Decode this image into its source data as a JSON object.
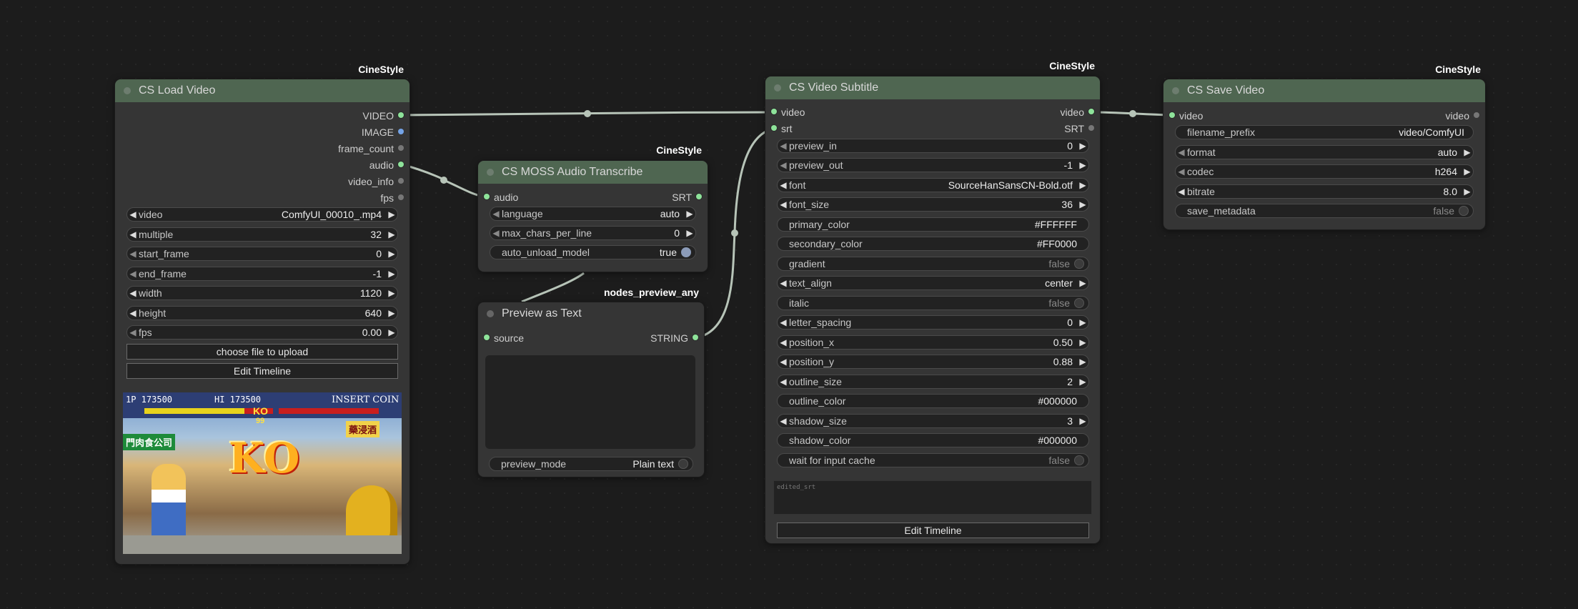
{
  "nodes": {
    "load_video": {
      "badge": "CineStyle",
      "title": "CS Load Video",
      "outputs": [
        "VIDEO",
        "IMAGE",
        "frame_count",
        "audio",
        "video_info",
        "fps"
      ],
      "widgets": [
        {
          "name": "video",
          "value": "ComfyUI_00010_.mp4"
        },
        {
          "name": "multiple",
          "value": "32"
        },
        {
          "name": "start_frame",
          "value": "0"
        },
        {
          "name": "end_frame",
          "value": "-1"
        },
        {
          "name": "width",
          "value": "1120"
        },
        {
          "name": "height",
          "value": "640"
        },
        {
          "name": "fps",
          "value": "0.00"
        }
      ],
      "upload_button": "choose file to upload",
      "timeline_button": "Edit Timeline",
      "preview": {
        "score_left": "1P  173500",
        "hi": "HI  173500",
        "insert_coin": "INSERT COIN",
        "ko": "KO",
        "timer": "99",
        "sign_left": "門肉食公司",
        "sign_right": "藥浸酒"
      }
    },
    "moss_audio": {
      "badge": "CineStyle",
      "title": "CS MOSS Audio Transcribe",
      "input": "audio",
      "output": "SRT",
      "widgets": [
        {
          "name": "language",
          "value": "auto"
        },
        {
          "name": "max_chars_per_line",
          "value": "0"
        },
        {
          "name": "auto_unload_model",
          "value": "true"
        }
      ]
    },
    "preview_text": {
      "badge": "nodes_preview_any",
      "title": "Preview as Text",
      "input": "source",
      "output": "STRING",
      "widget": {
        "name": "preview_mode",
        "value": "Plain text"
      }
    },
    "video_subtitle": {
      "badge": "CineStyle",
      "title": "CS Video Subtitle",
      "io": [
        {
          "input": "video",
          "output": "video"
        },
        {
          "input": "srt",
          "output": "SRT"
        }
      ],
      "widgets": [
        {
          "name": "preview_in",
          "value": "0"
        },
        {
          "name": "preview_out",
          "value": "-1"
        },
        {
          "name": "font",
          "value": "SourceHanSansCN-Bold.otf"
        },
        {
          "name": "font_size",
          "value": "36"
        },
        {
          "name": "primary_color",
          "value": "#FFFFFF"
        },
        {
          "name": "secondary_color",
          "value": "#FF0000"
        },
        {
          "name": "gradient",
          "value": "false"
        },
        {
          "name": "text_align",
          "value": "center"
        },
        {
          "name": "italic",
          "value": "false"
        },
        {
          "name": "letter_spacing",
          "value": "0"
        },
        {
          "name": "position_x",
          "value": "0.50"
        },
        {
          "name": "position_y",
          "value": "0.88"
        },
        {
          "name": "outline_size",
          "value": "2"
        },
        {
          "name": "outline_color",
          "value": "#000000"
        },
        {
          "name": "shadow_size",
          "value": "3"
        },
        {
          "name": "shadow_color",
          "value": "#000000"
        },
        {
          "name": "wait_for_input_cache",
          "label": "wait for input cache",
          "value": "false"
        }
      ],
      "textarea_placeholder": "edited_srt",
      "timeline_button": "Edit Timeline"
    },
    "save_video": {
      "badge": "CineStyle",
      "title": "CS Save Video",
      "input": "video",
      "output": "video",
      "widgets": [
        {
          "name": "filename_prefix",
          "value": "video/ComfyUI"
        },
        {
          "name": "format",
          "value": "auto"
        },
        {
          "name": "codec",
          "value": "h264"
        },
        {
          "name": "bitrate",
          "value": "8.0"
        },
        {
          "name": "save_metadata",
          "value": "false"
        }
      ]
    }
  },
  "colors": {
    "canvas": "#1c1c1c",
    "node_body": "#353535",
    "node_header": "#4f6651",
    "wire": "#b7c4b8",
    "slot_green": "#8ee39a",
    "slot_blue": "#74a3e6"
  }
}
